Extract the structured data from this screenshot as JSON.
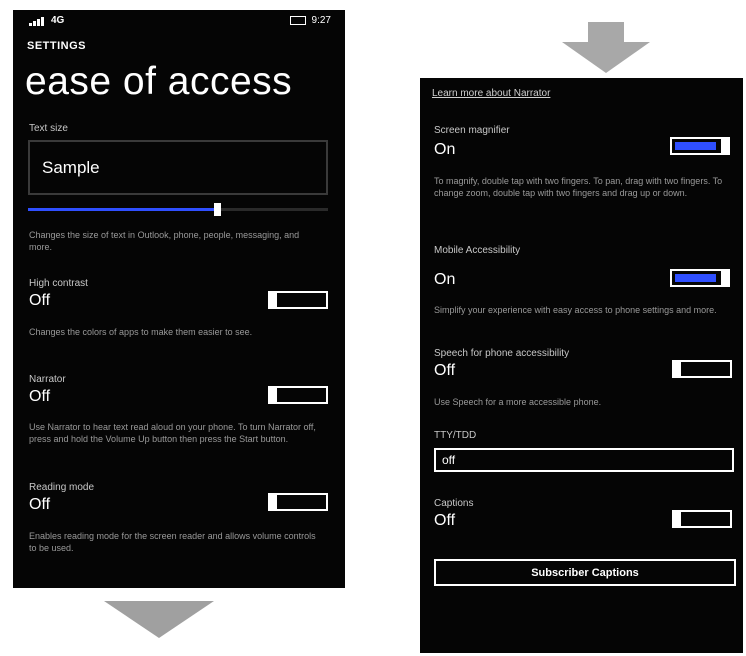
{
  "colors": {
    "accent": "#2f4fff",
    "background": "#050505",
    "text": "#ffffff"
  },
  "left_phone": {
    "status": {
      "signal_text": "4G",
      "battery_text": "9:27"
    },
    "settings_label": "SETTINGS",
    "title": "ease of access",
    "text_size": {
      "label": "Text size",
      "sample": "Sample",
      "value": 0.63,
      "description": "Changes the size of text in Outlook, phone, people, messaging, and more."
    },
    "high_contrast": {
      "label": "High contrast",
      "state": "Off",
      "on": false,
      "description": "Changes the colors of apps to make them easier to see."
    },
    "narrator": {
      "label": "Narrator",
      "state": "Off",
      "on": false,
      "description": "Use Narrator to hear text read aloud on your phone. To turn Narrator off, press and hold the Volume Up button then press the Start button."
    },
    "reading_mode": {
      "label": "Reading mode",
      "state": "Off",
      "on": false,
      "description": "Enables reading mode for the screen reader and allows volume controls to be used."
    }
  },
  "right_phone": {
    "learn_more": "Learn more about Narrator",
    "screen_magnifier": {
      "label": "Screen magnifier",
      "state": "On",
      "on": true,
      "description": "To magnify, double tap with two fingers. To pan, drag with two fingers. To change zoom, double tap with two fingers and drag up or down."
    },
    "mobile_accessibility": {
      "label": "Mobile Accessibility",
      "state": "On",
      "on": true,
      "description": "Simplify your experience with easy access to phone settings and more."
    },
    "speech_for_phone": {
      "label": "Speech for phone accessibility",
      "state": "Off",
      "on": false,
      "description": "Use Speech for a more accessible phone."
    },
    "tty_tdd": {
      "label": "TTY/TDD",
      "value": "off"
    },
    "captions": {
      "label": "Captions",
      "state": "Off",
      "on": false
    },
    "button_label": "Subscriber Captions"
  },
  "icons": {
    "arrow": "arrow-down-icon",
    "signal": "signal-icon",
    "battery": "battery-icon"
  }
}
